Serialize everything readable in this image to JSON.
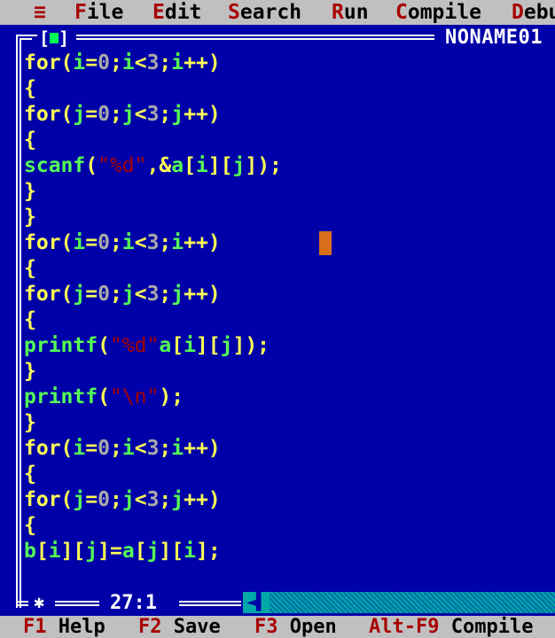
{
  "menu": {
    "system": "≡",
    "items": [
      {
        "hot": "F",
        "rest": "ile"
      },
      {
        "hot": "E",
        "rest": "dit"
      },
      {
        "hot": "S",
        "rest": "earch"
      },
      {
        "hot": "R",
        "rest": "un"
      },
      {
        "hot": "C",
        "rest": "ompile"
      },
      {
        "hot": "D",
        "rest": "ebu"
      }
    ]
  },
  "window": {
    "filename": "NONAME01",
    "position": "27:1"
  },
  "code": [
    [
      [
        "kw",
        "for"
      ],
      [
        "op",
        "("
      ],
      [
        "id",
        "i"
      ],
      [
        "op",
        "="
      ],
      [
        "num",
        "0"
      ],
      [
        "op",
        ";"
      ],
      [
        "id",
        "i"
      ],
      [
        "op",
        "<"
      ],
      [
        "num",
        "3"
      ],
      [
        "op",
        ";"
      ],
      [
        "id",
        "i"
      ],
      [
        "op",
        "++)"
      ]
    ],
    [
      [
        "op",
        "{"
      ]
    ],
    [
      [
        "kw",
        "for"
      ],
      [
        "op",
        "("
      ],
      [
        "id",
        "j"
      ],
      [
        "op",
        "="
      ],
      [
        "num",
        "0"
      ],
      [
        "op",
        ";"
      ],
      [
        "id",
        "j"
      ],
      [
        "op",
        "<"
      ],
      [
        "num",
        "3"
      ],
      [
        "op",
        ";"
      ],
      [
        "id",
        "j"
      ],
      [
        "op",
        "++)"
      ]
    ],
    [
      [
        "op",
        "{"
      ]
    ],
    [
      [
        "id",
        "scanf"
      ],
      [
        "op",
        "("
      ],
      [
        "str",
        "\"%d\""
      ],
      [
        "op",
        ",&"
      ],
      [
        "id",
        "a"
      ],
      [
        "op",
        "["
      ],
      [
        "id",
        "i"
      ],
      [
        "op",
        "]["
      ],
      [
        "id",
        "j"
      ],
      [
        "op",
        "]);"
      ]
    ],
    [
      [
        "op",
        "}"
      ]
    ],
    [
      [
        "op",
        "}"
      ]
    ],
    [
      [
        "kw",
        "for"
      ],
      [
        "op",
        "("
      ],
      [
        "id",
        "i"
      ],
      [
        "op",
        "="
      ],
      [
        "num",
        "0"
      ],
      [
        "op",
        ";"
      ],
      [
        "id",
        "i"
      ],
      [
        "op",
        "<"
      ],
      [
        "num",
        "3"
      ],
      [
        "op",
        ";"
      ],
      [
        "id",
        "i"
      ],
      [
        "op",
        "++)"
      ]
    ],
    [
      [
        "op",
        "{"
      ]
    ],
    [
      [
        "kw",
        "for"
      ],
      [
        "op",
        "("
      ],
      [
        "id",
        "j"
      ],
      [
        "op",
        "="
      ],
      [
        "num",
        "0"
      ],
      [
        "op",
        ";"
      ],
      [
        "id",
        "j"
      ],
      [
        "op",
        "<"
      ],
      [
        "num",
        "3"
      ],
      [
        "op",
        ";"
      ],
      [
        "id",
        "j"
      ],
      [
        "op",
        "++)"
      ]
    ],
    [
      [
        "op",
        "{"
      ]
    ],
    [
      [
        "id",
        "printf"
      ],
      [
        "op",
        "("
      ],
      [
        "str",
        "\"%d\""
      ],
      [
        "id",
        "a"
      ],
      [
        "op",
        "["
      ],
      [
        "id",
        "i"
      ],
      [
        "op",
        "]["
      ],
      [
        "id",
        "j"
      ],
      [
        "op",
        "]);"
      ]
    ],
    [
      [
        "op",
        "}"
      ]
    ],
    [
      [
        "id",
        "printf"
      ],
      [
        "op",
        "("
      ],
      [
        "str",
        "\"\\n\""
      ],
      [
        "op",
        ");"
      ]
    ],
    [
      [
        "op",
        "}"
      ]
    ],
    [
      [
        "kw",
        "for"
      ],
      [
        "op",
        "("
      ],
      [
        "id",
        "i"
      ],
      [
        "op",
        "="
      ],
      [
        "num",
        "0"
      ],
      [
        "op",
        ";"
      ],
      [
        "id",
        "i"
      ],
      [
        "op",
        "<"
      ],
      [
        "num",
        "3"
      ],
      [
        "op",
        ";"
      ],
      [
        "id",
        "i"
      ],
      [
        "op",
        "++)"
      ]
    ],
    [
      [
        "op",
        "{"
      ]
    ],
    [
      [
        "kw",
        "for"
      ],
      [
        "op",
        "("
      ],
      [
        "id",
        "j"
      ],
      [
        "op",
        "="
      ],
      [
        "num",
        "0"
      ],
      [
        "op",
        ";"
      ],
      [
        "id",
        "j"
      ],
      [
        "op",
        "<"
      ],
      [
        "num",
        "3"
      ],
      [
        "op",
        ";"
      ],
      [
        "id",
        "j"
      ],
      [
        "op",
        "++)"
      ]
    ],
    [
      [
        "op",
        "{"
      ]
    ],
    [
      [
        "id",
        "b"
      ],
      [
        "op",
        "["
      ],
      [
        "id",
        "i"
      ],
      [
        "op",
        "]["
      ],
      [
        "id",
        "j"
      ],
      [
        "op",
        "]="
      ],
      [
        "id",
        "a"
      ],
      [
        "op",
        "["
      ],
      [
        "id",
        "j"
      ],
      [
        "op",
        "]["
      ],
      [
        "id",
        "i"
      ],
      [
        "op",
        "];"
      ]
    ]
  ],
  "fnbar": [
    {
      "key": "F1",
      "label": "Help"
    },
    {
      "key": "F2",
      "label": "Save"
    },
    {
      "key": "F3",
      "label": "Open"
    },
    {
      "key": "Alt-F9",
      "label": "Compile"
    }
  ],
  "icons": {
    "close_box": "close-box-icon",
    "resize": "resize-star-icon",
    "scroll_left": "scroll-left-arrow-icon"
  },
  "colors": {
    "background": "#0000a8",
    "menu_bg": "#c0c0c0",
    "hotkey": "#a80000",
    "keyword": "#ffff55",
    "identifier": "#55ff55",
    "cursor": "#ff8000"
  }
}
